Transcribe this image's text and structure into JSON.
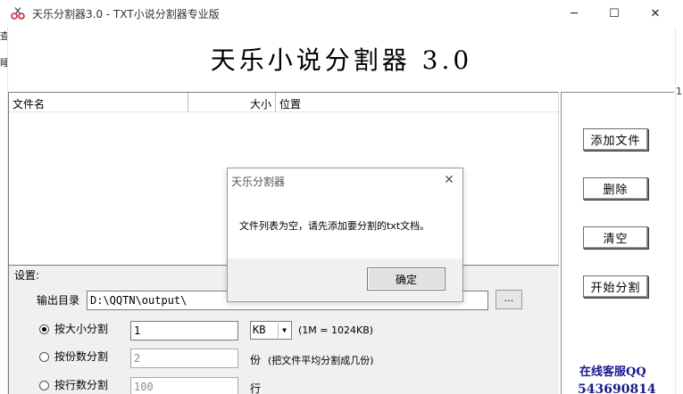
{
  "window": {
    "title": "天乐分割器3.0 - TXT小说分割器专业版",
    "minimize_glyph": "─",
    "maximize_glyph": "☐",
    "close_glyph": "✕",
    "icon": "scissors-icon"
  },
  "background_fragments": {
    "left_top": "查",
    "left_mid": "睡",
    "right_mid": "18"
  },
  "banner": {
    "title": "天乐小说分割器 3.0"
  },
  "file_list": {
    "columns": [
      "文件名",
      "大小",
      "位置"
    ],
    "rows": []
  },
  "right_panel": {
    "add_file": "添加文件",
    "delete": "删除",
    "clear": "清空",
    "start_split": "开始分割",
    "qq_label": "在线客服QQ",
    "qq_number": "543690814"
  },
  "settings": {
    "group_label": "设置:",
    "output_dir_label": "输出目录",
    "output_dir_value": "D:\\QQTN\\output\\",
    "browse_label": "...",
    "split_by_size_label": "按大小分割",
    "split_by_size_value": "1",
    "size_unit": "KB",
    "size_unit_arrow": "▼",
    "size_note": "(1M = 1024KB)",
    "split_by_parts_label": "按份数分割",
    "split_by_parts_value": "2",
    "parts_unit": "份",
    "parts_note": "(把文件平均分割成几份)",
    "split_by_lines_label": "按行数分割",
    "split_by_lines_value": "100",
    "lines_unit": "行",
    "selected_mode": "split_by_size"
  },
  "dialog": {
    "title": "天乐分割器",
    "close_glyph": "✕",
    "message": "文件列表为空，请先添加要分割的txt文档。",
    "ok_label": "确定"
  },
  "colors": {
    "qq_text": "#1a1a8c",
    "settings_bg": "#f0f0f0"
  }
}
